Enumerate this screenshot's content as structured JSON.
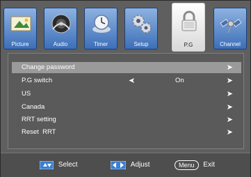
{
  "tabs": [
    {
      "label": "Picture",
      "icon": "picture-icon"
    },
    {
      "label": "Audio",
      "icon": "audio-icon"
    },
    {
      "label": "Timer",
      "icon": "timer-icon"
    },
    {
      "label": "Setup",
      "icon": "setup-icon"
    },
    {
      "label": "P.G",
      "icon": "lock-icon",
      "active": true
    },
    {
      "label": "Channel",
      "icon": "satellite-icon"
    }
  ],
  "menu": {
    "items": [
      {
        "label": "Change password",
        "highlighted": true
      },
      {
        "label": "P.G switch",
        "value": "On"
      },
      {
        "label": "US"
      },
      {
        "label": "Canada"
      },
      {
        "label": "RRT setting"
      },
      {
        "label": "Reset  RRT"
      }
    ],
    "arrow": "➤",
    "left_arrow": "➤"
  },
  "footer": {
    "select_label": "Select",
    "adjust_label": "Adjust",
    "menu_key": "Menu",
    "exit_label": "Exit"
  },
  "colors": {
    "tab_blue": "#3d6fb8",
    "highlight": "#9a9a9a",
    "background": "#5f5f5f"
  }
}
